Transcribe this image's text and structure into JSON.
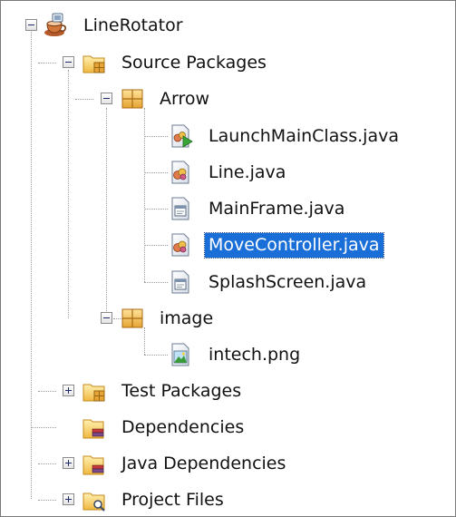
{
  "tree": {
    "project": {
      "label": "LineRotator",
      "icon": "coffee-cup-project-icon",
      "expanded": true
    },
    "source_packages": {
      "label": "Source Packages",
      "icon": "source-folder-icon",
      "expanded": true
    },
    "package_arrow": {
      "label": "Arrow",
      "icon": "package-icon",
      "expanded": true,
      "files": [
        {
          "label": "LaunchMainClass.java",
          "icon": "java-main-class-icon"
        },
        {
          "label": "Line.java",
          "icon": "java-class-icon"
        },
        {
          "label": "MainFrame.java",
          "icon": "java-form-icon"
        },
        {
          "label": "MoveController.java",
          "icon": "java-class-icon",
          "selected": true
        },
        {
          "label": "SplashScreen.java",
          "icon": "java-form-icon"
        }
      ]
    },
    "package_image": {
      "label": "image",
      "icon": "package-icon",
      "expanded": true,
      "files": [
        {
          "label": "intech.png",
          "icon": "image-file-icon"
        }
      ]
    },
    "test_packages": {
      "label": "Test Packages",
      "icon": "test-folder-icon",
      "expanded": false
    },
    "dependencies": {
      "label": "Dependencies",
      "icon": "library-folder-icon"
    },
    "java_dependencies": {
      "label": "Java Dependencies",
      "icon": "library-folder-icon",
      "expanded": false
    },
    "project_files": {
      "label": "Project Files",
      "icon": "project-files-folder-icon",
      "expanded": false
    }
  },
  "colors": {
    "selection": "#1a6ed8",
    "selection_text": "#ffffff",
    "folder": "#f5c95a",
    "package": "#e9b04a"
  }
}
